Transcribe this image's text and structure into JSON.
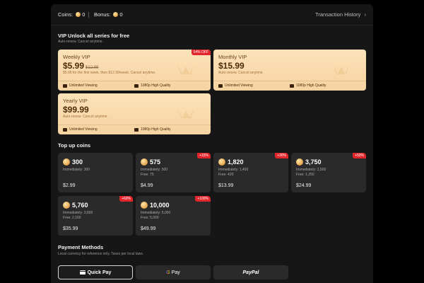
{
  "header": {
    "coins_label": "Coins:",
    "coins_value": "0",
    "bonus_label": "Bonus:",
    "bonus_value": "0",
    "history_label": "Transaction History",
    "history_chevron": "›"
  },
  "vip_section": {
    "title": "VIP Unlock all series for free",
    "subtitle": "Auto-renew. Cancel anytime.",
    "plans": [
      {
        "name": "Weekly VIP",
        "price": "$5.99",
        "original_price": "$12.99",
        "description": "$5.99 for the first week, then $12.99/week. Cancel anytime.",
        "badge": "54% OFF",
        "features": [
          "Unlimited Viewing",
          "1080p High Quality"
        ]
      },
      {
        "name": "Monthly VIP",
        "price": "$15.99",
        "description": "Auto-renew. Cancel anytime.",
        "features": [
          "Unlimited Viewing",
          "1080p High Quality"
        ]
      },
      {
        "name": "Yearly VIP",
        "price": "$99.99",
        "description": "Auto-renew. Cancel anytime.",
        "features": [
          "Unlimited Viewing",
          "1080p High Quality"
        ]
      }
    ]
  },
  "topup_section": {
    "title": "Top up coins",
    "packages": [
      {
        "amount": "300",
        "immediately": "Immediately: 300",
        "free": "",
        "price": "$2.99",
        "badge": ""
      },
      {
        "amount": "575",
        "immediately": "Immediately: 500",
        "free": "Free: 75",
        "price": "$4.99",
        "badge": "+15%"
      },
      {
        "amount": "1,820",
        "immediately": "Immediately: 1,400",
        "free": "Free: 420",
        "price": "$13.99",
        "badge": "+30%"
      },
      {
        "amount": "3,750",
        "immediately": "Immediately: 2,500",
        "free": "Free: 1,250",
        "price": "$24.99",
        "badge": "+50%"
      },
      {
        "amount": "5,760",
        "immediately": "Immediately: 3,600",
        "free": "Free: 2,160",
        "price": "$35.99",
        "badge": "+60%"
      },
      {
        "amount": "10,000",
        "immediately": "Immediately: 5,000",
        "free": "Free: 5,000",
        "price": "$49.99",
        "badge": "+100%"
      }
    ]
  },
  "payment_section": {
    "title": "Payment Methods",
    "subtitle": "Local currency for reference only. Taxes per local laws.",
    "methods": [
      {
        "label": "Quick Pay",
        "icon": "credit-card-icon",
        "selected": true
      },
      {
        "label": "Pay",
        "icon": "google-g-icon",
        "prefix": "G",
        "selected": false
      },
      {
        "label": "PayPal",
        "icon": "paypal-logo",
        "selected": false
      }
    ]
  },
  "colors": {
    "background": "#000000",
    "panel": "#161616",
    "card": "#2a2a2a",
    "vip_gold": "#f6d3a1",
    "badge_red": "#e2242b"
  }
}
